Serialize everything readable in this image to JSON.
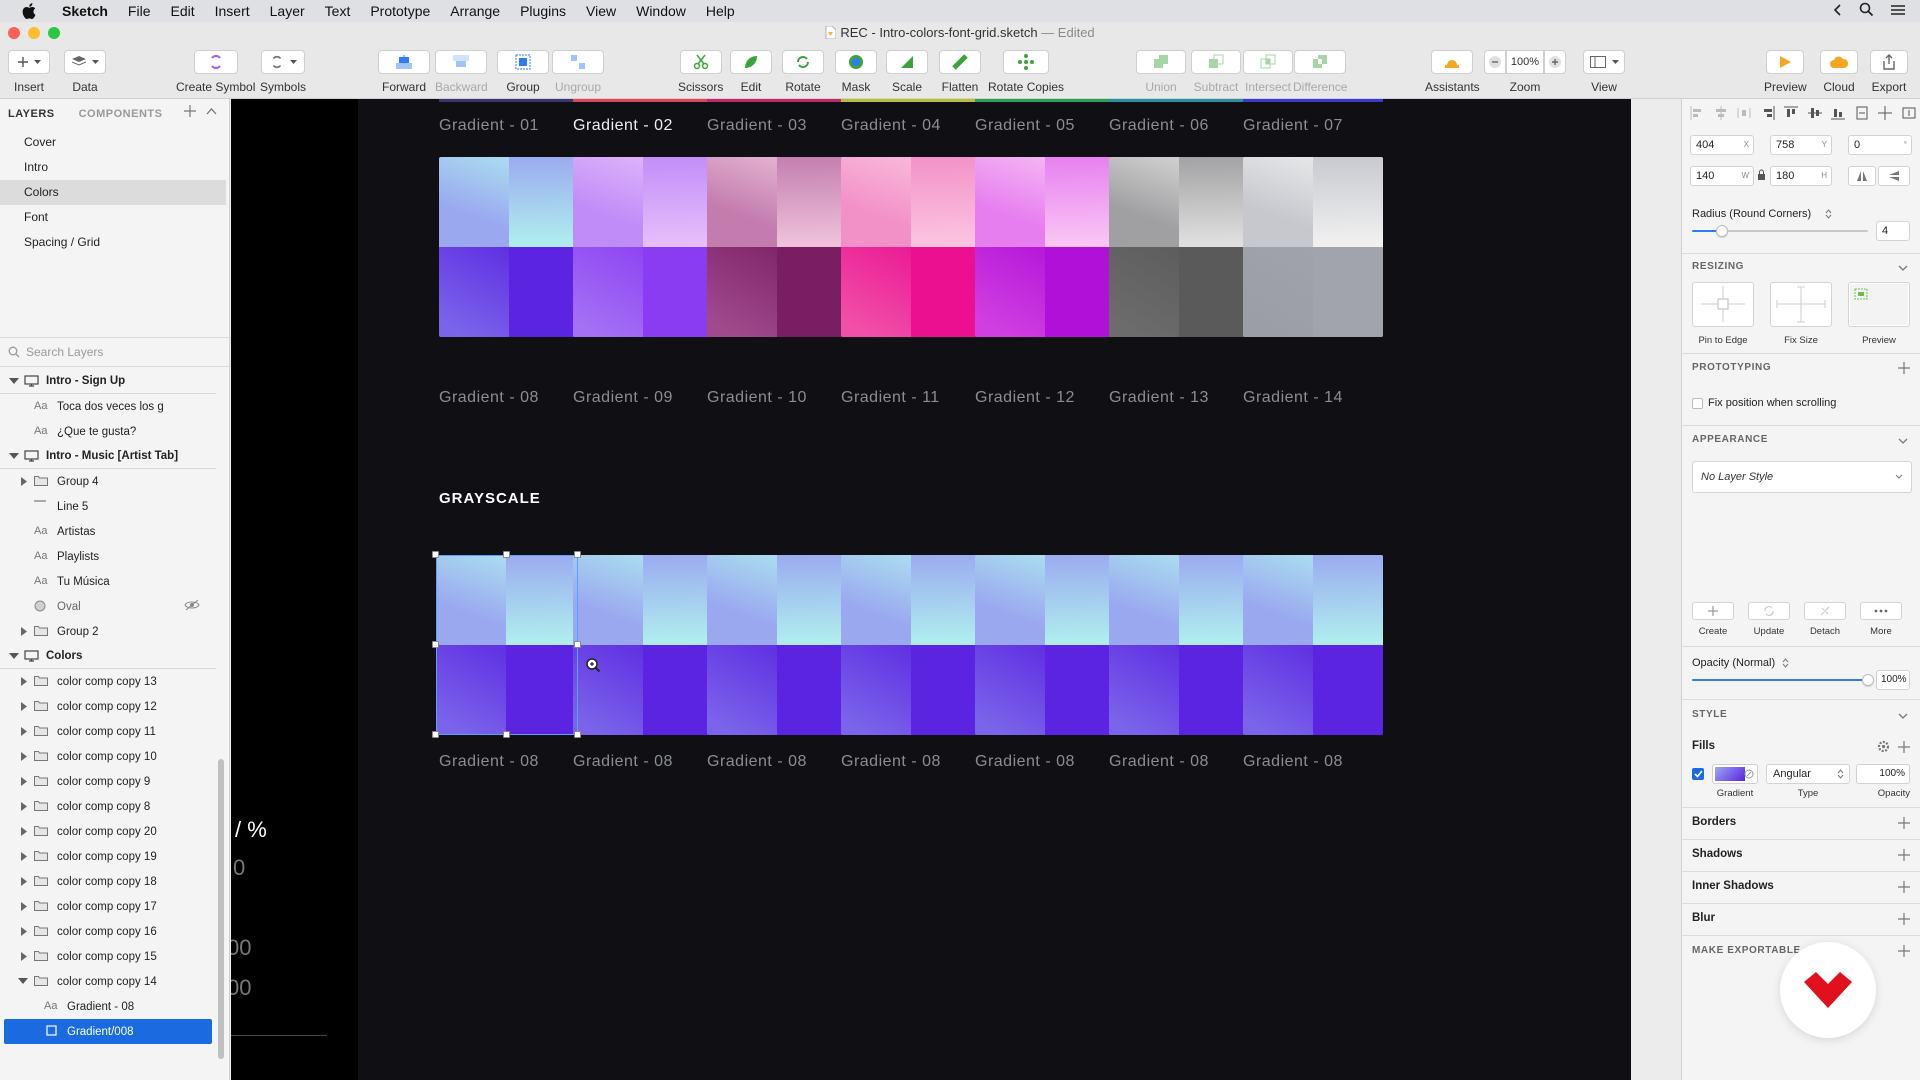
{
  "menubar": {
    "app": "Sketch",
    "items": [
      "File",
      "Edit",
      "Insert",
      "Layer",
      "Text",
      "Prototype",
      "Arrange",
      "Plugins",
      "View",
      "Window",
      "Help"
    ]
  },
  "window": {
    "title": "REC - Intro-colors-font-grid.sketch",
    "edited": "— Edited"
  },
  "toolbar": {
    "insert": "Insert",
    "data": "Data",
    "create_symbol": "Create Symbol",
    "symbols": "Symbols",
    "forward": "Forward",
    "backward": "Backward",
    "group": "Group",
    "ungroup": "Ungroup",
    "scissors": "Scissors",
    "edit": "Edit",
    "rotate": "Rotate",
    "mask": "Mask",
    "scale": "Scale",
    "flatten": "Flatten",
    "rotate_copies": "Rotate Copies",
    "union": "Union",
    "subtract": "Subtract",
    "intersect": "Intersect",
    "difference": "Difference",
    "assistants": "Assistants",
    "zoom": "Zoom",
    "zoom_value": "100%",
    "view": "View",
    "preview": "Preview",
    "cloud": "Cloud",
    "export": "Export"
  },
  "sidebar": {
    "tab_layers": "LAYERS",
    "tab_components": "COMPONENTS",
    "pages": [
      "Cover",
      "Intro",
      "Colors",
      "Font",
      "Spacing / Grid"
    ],
    "selected_page": "Colors",
    "search_placeholder": "Search Layers",
    "layers": [
      {
        "name": "Intro - Sign Up",
        "kind": "artboard"
      },
      {
        "name": "Toca dos veces los g",
        "kind": "text"
      },
      {
        "name": "¿Que te gusta?",
        "kind": "text"
      },
      {
        "name": "Intro - Music [Artist Tab]",
        "kind": "artboard"
      },
      {
        "name": "Group 4",
        "kind": "group"
      },
      {
        "name": "Line 5",
        "kind": "line"
      },
      {
        "name": "Artistas",
        "kind": "text"
      },
      {
        "name": "Playlists",
        "kind": "text"
      },
      {
        "name": "Tu Música",
        "kind": "text"
      },
      {
        "name": "Oval",
        "kind": "oval"
      },
      {
        "name": "Group 2",
        "kind": "group"
      },
      {
        "name": "Colors",
        "kind": "artboard"
      },
      {
        "name": "color comp copy 13",
        "kind": "group"
      },
      {
        "name": "color comp copy 12",
        "kind": "group"
      },
      {
        "name": "color comp copy 11",
        "kind": "group"
      },
      {
        "name": "color comp copy 10",
        "kind": "group"
      },
      {
        "name": "color comp copy 9",
        "kind": "group"
      },
      {
        "name": "color comp copy 8",
        "kind": "group"
      },
      {
        "name": "color comp copy 20",
        "kind": "group"
      },
      {
        "name": "color comp copy 19",
        "kind": "group"
      },
      {
        "name": "color comp copy 18",
        "kind": "group"
      },
      {
        "name": "color comp copy 17",
        "kind": "group"
      },
      {
        "name": "color comp copy 16",
        "kind": "group"
      },
      {
        "name": "color comp copy 15",
        "kind": "group"
      },
      {
        "name": "color comp copy 14",
        "kind": "group-open"
      },
      {
        "name": "Gradient - 08",
        "kind": "text-child"
      },
      {
        "name": "Gradient/008",
        "kind": "rect-selected"
      }
    ]
  },
  "canvas": {
    "left_board_text": "/ %",
    "left_board_faded": [
      "0",
      "00",
      "00"
    ],
    "row1_labels": [
      "Gradient - 01",
      "Gradient - 02",
      "Gradient - 03",
      "Gradient - 04",
      "Gradient - 05",
      "Gradient - 06",
      "Gradient - 07"
    ],
    "row1_strip_colors": [
      "#3a3470",
      "#e0455a",
      "#c02a6a",
      "#b8c03a",
      "#2aa05a",
      "#2a90a0",
      "#3a3ad0"
    ],
    "row2_labels": [
      "Gradient - 08",
      "Gradient - 09",
      "Gradient - 10",
      "Gradient - 11",
      "Gradient - 12",
      "Gradient - 13",
      "Gradient - 14"
    ],
    "row2_tiles": [
      {
        "tl": "#9aa8f0",
        "tr": "#b0f0ee",
        "bl": "#7a64ea",
        "br": "#5a24e0"
      },
      {
        "tl": "#c08cf8",
        "tr": "#e8c0fa",
        "bl": "#a470f4",
        "br": "#8a3cf2"
      },
      {
        "tl": "#c27cae",
        "tr": "#f0c4dc",
        "bl": "#a04a8c",
        "br": "#7a1e64"
      },
      {
        "tl": "#f290c8",
        "tr": "#fcc6e0",
        "bl": "#f050a8",
        "br": "#ea1090"
      },
      {
        "tl": "#e67ef0",
        "tr": "#fac8f4",
        "bl": "#d040e0",
        "br": "#b010d8"
      },
      {
        "tl": "#a0a0a2",
        "tr": "#e2e2e2",
        "bl": "#6c6c6c",
        "br": "#5a5a5a"
      },
      {
        "tl": "#c6c8ce",
        "tr": "#f2f2f2",
        "bl": "#9c9ea6",
        "br": "#a2a4ac"
      }
    ],
    "section_title": "GRAYSCALE",
    "row3_labels": [
      "Gradient - 08",
      "Gradient - 08",
      "Gradient - 08",
      "Gradient - 08",
      "Gradient - 08",
      "Gradient - 08",
      "Gradient - 08"
    ],
    "row3_tile": {
      "tl": "#9aa8f0",
      "tr": "#b0f0ee",
      "bl": "#7a64ea",
      "br": "#5a24e0"
    }
  },
  "inspector": {
    "x": "404",
    "y": "758",
    "rotation": "0",
    "w": "140",
    "h": "180",
    "x_suffix": "X",
    "y_suffix": "Y",
    "w_suffix": "W",
    "h_suffix": "H",
    "rot_suffix": "°",
    "radius_label": "Radius (Round Corners)",
    "radius_value": "4",
    "radius_level": 0.04,
    "resizing": "RESIZING",
    "pin_to_edge": "Pin to Edge",
    "fix_size": "Fix Size",
    "preview": "Preview",
    "prototyping": "PROTOTYPING",
    "fix_position": "Fix position when scrolling",
    "appearance": "APPEARANCE",
    "layer_style": "No Layer Style",
    "create": "Create",
    "update": "Update",
    "detach": "Detach",
    "more": "More",
    "opacity_label": "Opacity (Normal)",
    "opacity_value": "100%",
    "opacity_level": 1.0,
    "style": "STYLE",
    "fills": "Fills",
    "fill_type": "Angular",
    "fill_opacity": "100%",
    "gradient": "Gradient",
    "type": "Type",
    "opacity": "Opacity",
    "borders": "Borders",
    "shadows": "Shadows",
    "inner_shadows": "Inner Shadows",
    "blur": "Blur",
    "make_exportable": "MAKE EXPORTABLE",
    "accent": "#1a6ae0"
  }
}
